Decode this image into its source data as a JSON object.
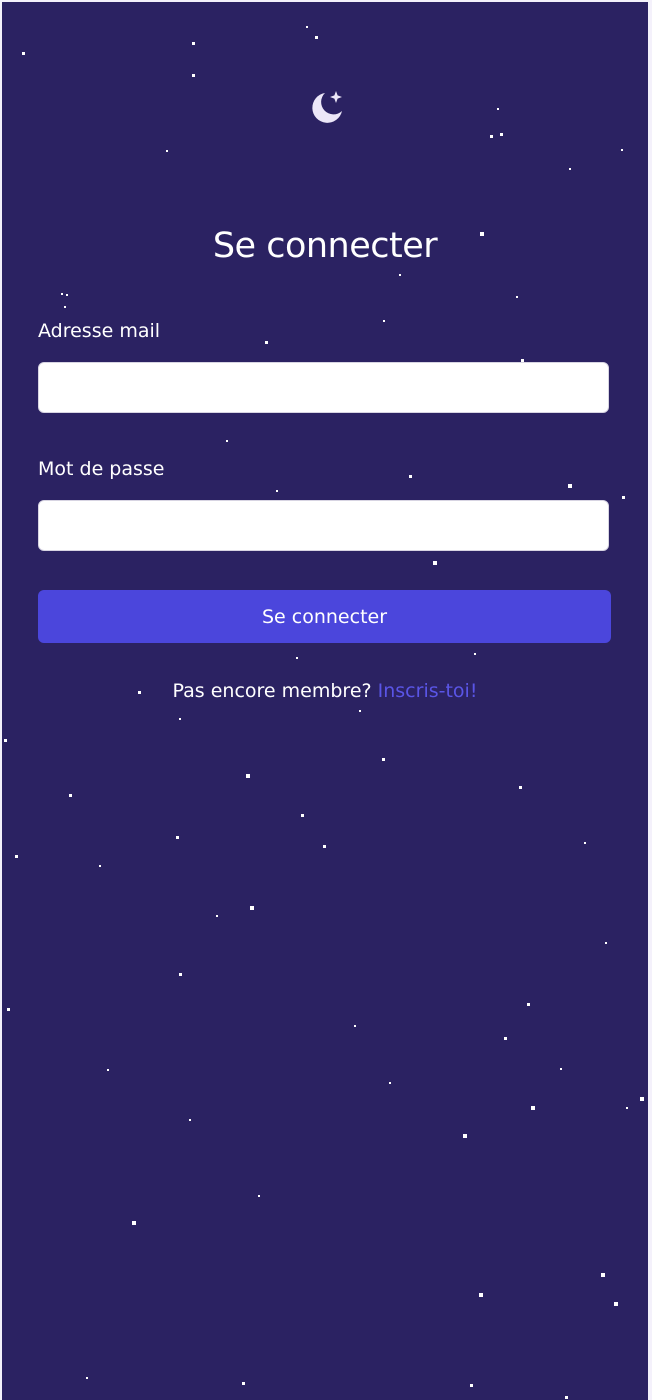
{
  "theme": {
    "background": "#2b2262",
    "accent": "#4b46dc",
    "link": "#5a55e6",
    "text": "#ffffff"
  },
  "logo": {
    "icon": "moon-star-icon"
  },
  "login": {
    "title": "Se connecter",
    "email_label": "Adresse mail",
    "email_value": "",
    "password_label": "Mot de passe",
    "password_value": "",
    "submit_label": "Se connecter"
  },
  "signup": {
    "prompt": "Pas encore membre?",
    "link_label": "Inscris-toi!"
  }
}
